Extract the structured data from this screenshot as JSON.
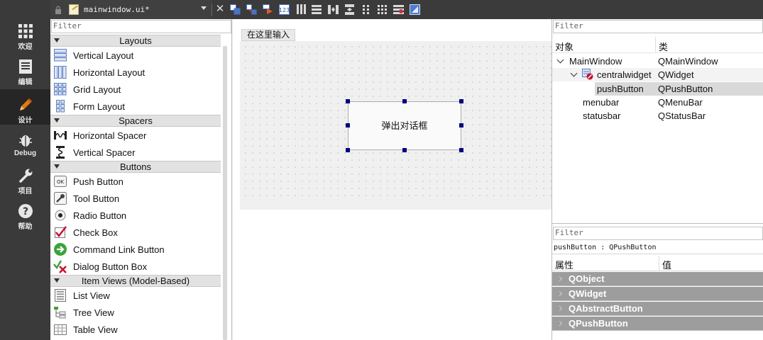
{
  "modes": [
    {
      "label": "欢迎",
      "icon": "grid-icon"
    },
    {
      "label": "编辑",
      "icon": "document-icon"
    },
    {
      "label": "设计",
      "icon": "pencil-icon",
      "active": true
    },
    {
      "label": "Debug",
      "icon": "bug-icon"
    },
    {
      "label": "项目",
      "icon": "wrench-icon"
    },
    {
      "label": "帮助",
      "icon": "help-icon"
    }
  ],
  "toolbar": {
    "file_name": "mainwindow.ui*"
  },
  "widget_box": {
    "filter_placeholder": "Filter",
    "categories": [
      {
        "label": "Layouts",
        "items": [
          "Vertical Layout",
          "Horizontal Layout",
          "Grid Layout",
          "Form Layout"
        ]
      },
      {
        "label": "Spacers",
        "items": [
          "Horizontal Spacer",
          "Vertical Spacer"
        ]
      },
      {
        "label": "Buttons",
        "items": [
          "Push Button",
          "Tool Button",
          "Radio Button",
          "Check Box",
          "Command Link Button",
          "Dialog Button Box"
        ]
      },
      {
        "label": "Item Views (Model-Based)",
        "items": [
          "List View",
          "Tree View",
          "Table View"
        ]
      }
    ]
  },
  "form": {
    "menu_placeholder": "在这里输入",
    "push_button_text": "弹出对话框"
  },
  "object_inspector": {
    "filter_placeholder": "Filter",
    "col_object": "对象",
    "col_class": "类",
    "rows": [
      {
        "name": "MainWindow",
        "class": "QMainWindow"
      },
      {
        "name": "centralwidget",
        "class": "QWidget"
      },
      {
        "name": "pushButton",
        "class": "QPushButton"
      },
      {
        "name": "menubar",
        "class": "QMenuBar"
      },
      {
        "name": "statusbar",
        "class": "QStatusBar"
      }
    ]
  },
  "property_editor": {
    "filter_placeholder": "Filter",
    "object_label": "pushButton : QPushButton",
    "col_property": "属性",
    "col_value": "值",
    "groups": [
      "QObject",
      "QWidget",
      "QAbstractButton",
      "QPushButton"
    ]
  },
  "colors": {
    "modebar": "#3a3a3a",
    "selection_handle": "#000080",
    "group_header": "#9d9d9d"
  }
}
